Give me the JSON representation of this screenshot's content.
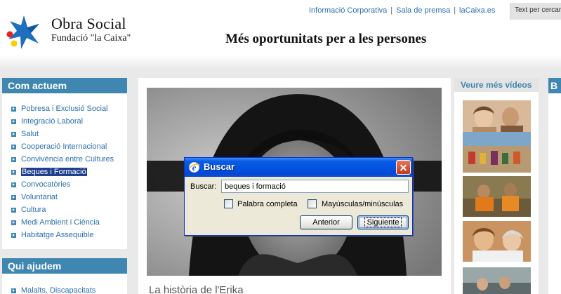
{
  "header": {
    "logo_title": "Obra Social",
    "logo_subtitle": "Fundació \"la Caixa\"",
    "nav": [
      "Informació Corporativa",
      "Sala de premsa",
      "laCaixa.es"
    ],
    "text_size_label": "Text per cercar",
    "tagline": "Més oportunitats per a les persones"
  },
  "sidebar": {
    "box1": {
      "title": "Com actuem",
      "items": [
        {
          "label": "Pobresa i Exclusió Social"
        },
        {
          "label": "Integració Laboral"
        },
        {
          "label": "Salut"
        },
        {
          "label": "Cooperació Internacional"
        },
        {
          "label": "Convivència entre Cultures"
        },
        {
          "label": "Beques i Formació",
          "selected": true
        },
        {
          "label": "Convocatòries"
        },
        {
          "label": "Voluntariat"
        },
        {
          "label": "Cultura"
        },
        {
          "label": "Medi Ambient i Ciència"
        },
        {
          "label": "Habitatge Assequible"
        }
      ]
    },
    "box2": {
      "title": "Qui ajudem",
      "items": [
        {
          "label": "Malalts, Discapacitats"
        }
      ]
    }
  },
  "main": {
    "video_title": "La història de l'Erika"
  },
  "videos": {
    "title": "Veure més vídeos"
  },
  "rightmost": {
    "title": "B"
  },
  "find_dialog": {
    "title": "Buscar",
    "find_label": "Buscar:",
    "find_value": "beques i formació",
    "whole_word_label": "Palabra completa",
    "match_case_label": "Mayúsculas/minúsculas",
    "prev_button": "Anterior",
    "next_button": "Siguiente",
    "whole_word_checked": false,
    "match_case_checked": false
  },
  "colors": {
    "accent_blue": "#3f86b1",
    "link_blue": "#2a6fae",
    "selection": "#1f3f8f",
    "xp_title": "#0353e2"
  }
}
